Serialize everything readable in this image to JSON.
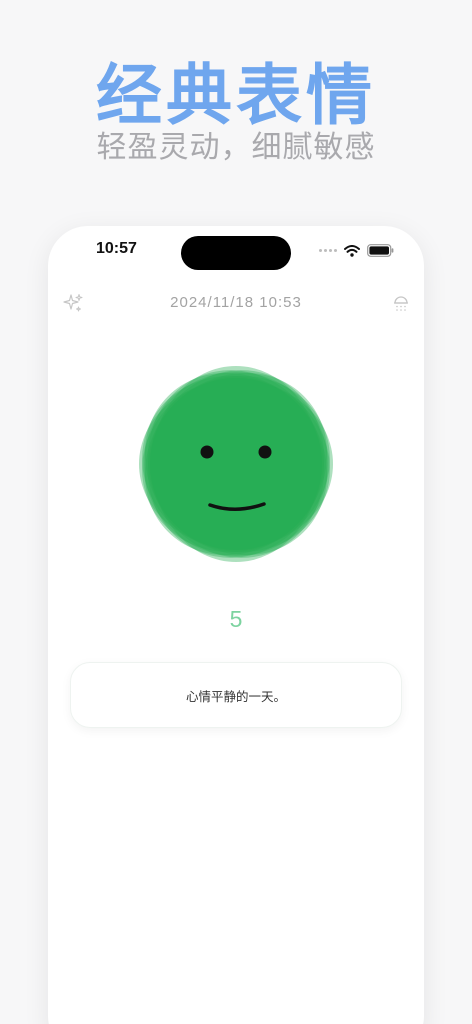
{
  "promo": {
    "headline": "经典表情",
    "subline": "轻盈灵动，细腻敏感"
  },
  "status_bar": {
    "time": "10:57"
  },
  "header": {
    "datetime": "2024/11/18 10:53",
    "left_icon": "sparkles-icon",
    "right_icon": "cloud-rain-icon"
  },
  "mood": {
    "face_icon": "smiley-face-icon",
    "score": "5",
    "color": "#27ae55",
    "note": "心情平静的一天。"
  },
  "colors": {
    "accent": "#6fa6ee",
    "score_text": "#7dd3a0"
  }
}
